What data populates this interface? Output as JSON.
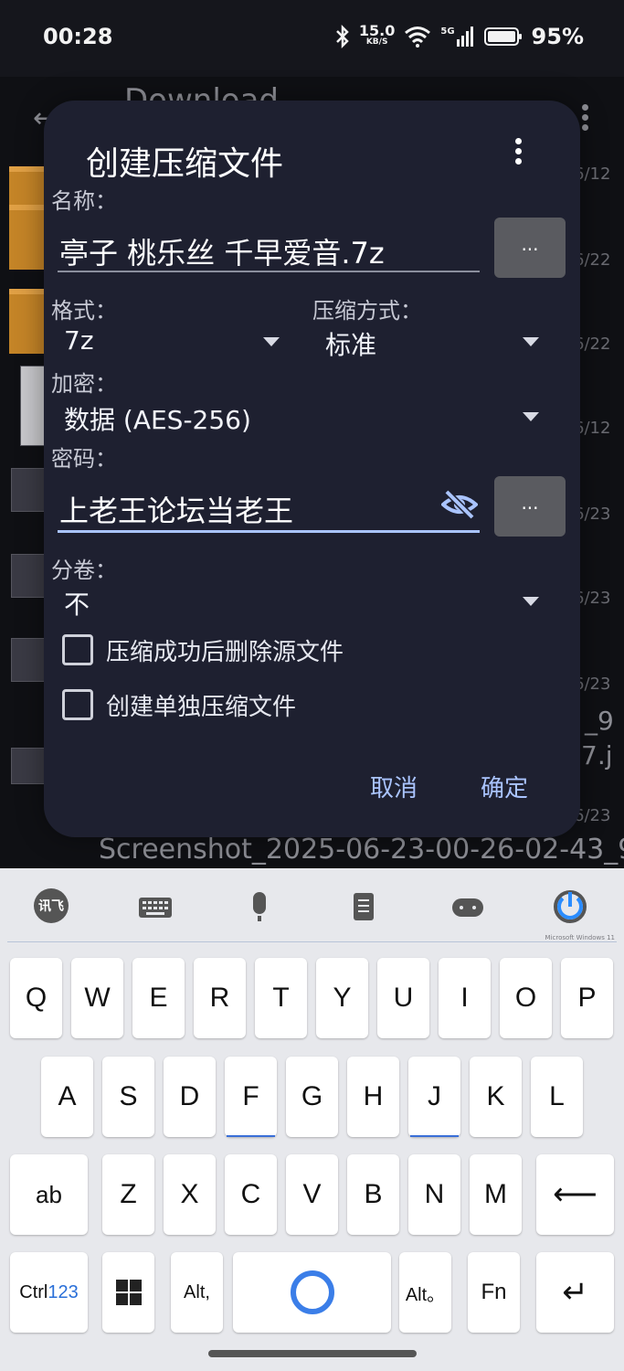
{
  "status_bar": {
    "time": "00:28",
    "net_speed_value": "15.0",
    "net_speed_unit": "KB/S",
    "signal_label": "5G",
    "battery": "95%"
  },
  "background": {
    "title": "Download",
    "dates": [
      "6/12",
      "6/22",
      "6/22",
      "6/12",
      "6/23",
      "6/23",
      "6/23",
      "6/23"
    ],
    "frag_1": "_9",
    "frag_2": "7.j",
    "filename": "Screenshot_2025-06-23-00-26-02-43_9"
  },
  "dialog": {
    "title": "创建压缩文件",
    "name_label": "名称：",
    "name_value": "亭子 桃乐丝 千早爱音.7z",
    "browse_label": "...",
    "format_label": "格式：",
    "format_value": "7z",
    "compression_label": "压缩方式：",
    "compression_value": "标准",
    "encryption_label": "加密：",
    "encryption_value": "数据 (AES-256)",
    "password_label": "密码：",
    "password_value": "上老王论坛当老王",
    "password_more_label": "...",
    "split_label": "分卷：",
    "split_value": "不",
    "delete_source_label": "压缩成功后删除源文件",
    "separate_archives_label": "创建单独压缩文件",
    "cancel_label": "取消",
    "ok_label": "确定"
  },
  "keyboard": {
    "toolbar_brand": "Microsoft Windows 11",
    "ime_logo": "讯飞",
    "row1": [
      "Q",
      "W",
      "E",
      "R",
      "T",
      "Y",
      "U",
      "I",
      "O",
      "P"
    ],
    "row2": [
      "A",
      "S",
      "D",
      "F",
      "G",
      "H",
      "J",
      "K",
      "L"
    ],
    "row3": [
      "ab",
      "Z",
      "X",
      "C",
      "V",
      "B",
      "N",
      "M"
    ],
    "ctrl_label": "Ctrl",
    "num_label": "123",
    "alt_left_label": "Alt,",
    "alt_right_label": "Alt。",
    "fn_label": "Fn",
    "backspace_label": "⟵",
    "enter_label": "↵"
  },
  "colors": {
    "dialog_bg": "#1e2030",
    "accent": "#aac4ff",
    "keyboard_bg": "#e7e8ec"
  }
}
